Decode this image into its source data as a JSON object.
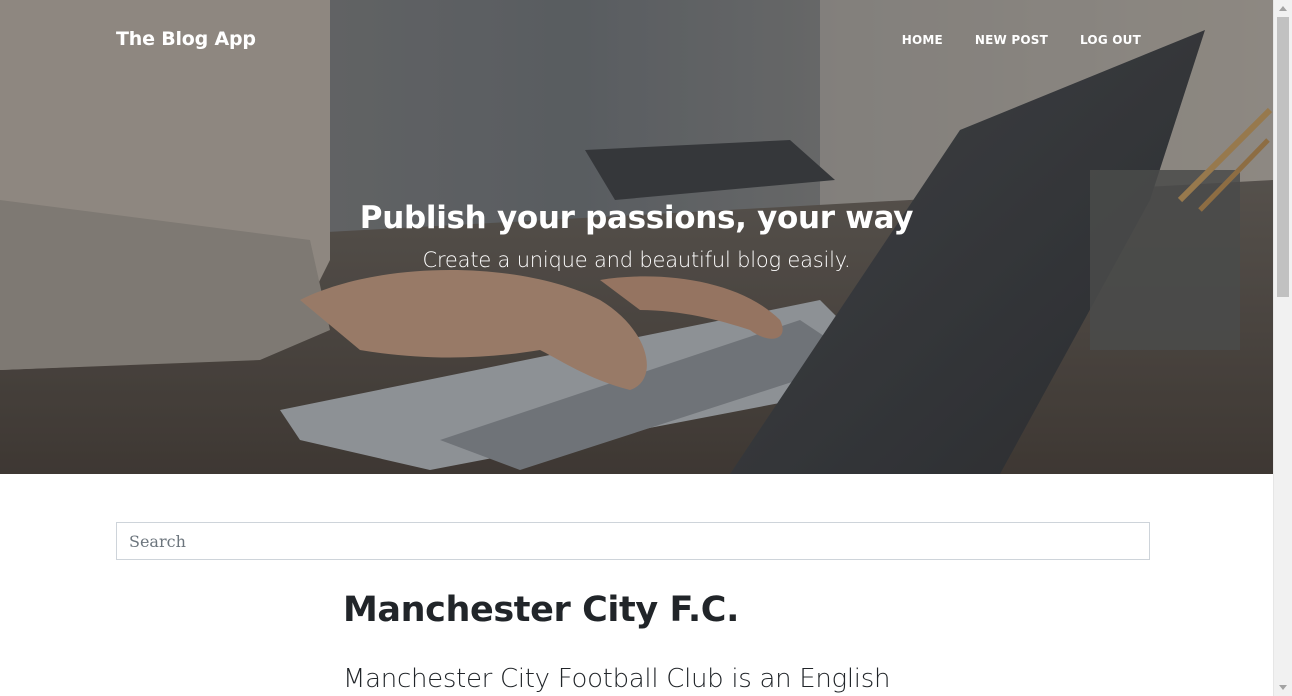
{
  "navbar": {
    "brand": "The Blog App",
    "links": [
      "HOME",
      "NEW POST",
      "LOG OUT"
    ]
  },
  "hero": {
    "heading": "Publish your passions, your way",
    "subheading": "Create a unique and beautiful blog easily."
  },
  "search": {
    "placeholder": "Search",
    "value": ""
  },
  "posts": [
    {
      "title": "Manchester City F.C.",
      "subtitle": "Manchester City Football Club is an English"
    }
  ],
  "colors": {
    "text": "#212529",
    "hero_overlay": "#212529",
    "input_border": "#ced4da",
    "placeholder": "#6c757d"
  }
}
